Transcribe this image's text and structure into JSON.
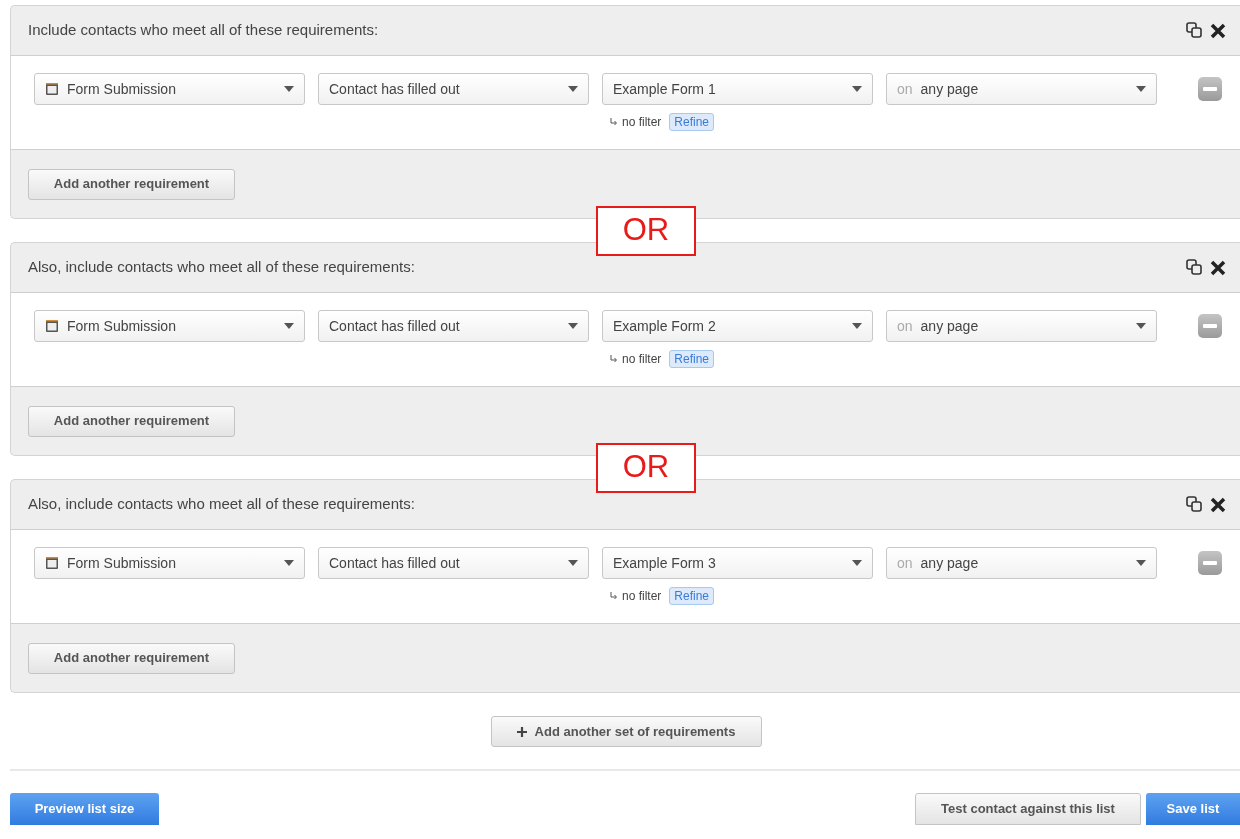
{
  "groups": [
    {
      "title": "Include contacts who meet all of these requirements:",
      "requirements": [
        {
          "type": "Form Submission",
          "operator": "Contact has filled out",
          "form": "Example Form 1",
          "page_prefix": "on",
          "page": "any page",
          "filter": "no filter",
          "refine": "Refine"
        }
      ],
      "add_button": "Add another requirement"
    },
    {
      "separator": "OR",
      "title": "Also, include contacts who meet all of these requirements:",
      "requirements": [
        {
          "type": "Form Submission",
          "operator": "Contact has filled out",
          "form": "Example Form 2",
          "page_prefix": "on",
          "page": "any page",
          "filter": "no filter",
          "refine": "Refine"
        }
      ],
      "add_button": "Add another requirement"
    },
    {
      "separator": "OR",
      "title": "Also, include contacts who meet all of these requirements:",
      "requirements": [
        {
          "type": "Form Submission",
          "operator": "Contact has filled out",
          "form": "Example Form 3",
          "page_prefix": "on",
          "page": "any page",
          "filter": "no filter",
          "refine": "Refine"
        }
      ],
      "add_button": "Add another requirement"
    }
  ],
  "add_set_button": "Add another set of requirements",
  "footer": {
    "preview_button": "Preview list size",
    "test_button": "Test contact against this list",
    "save_button": "Save list"
  }
}
